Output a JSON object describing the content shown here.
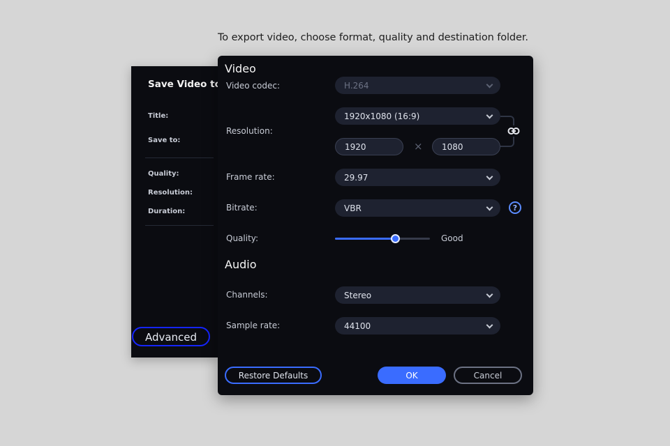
{
  "caption": "To export video, choose format, quality and destination folder.",
  "back_panel": {
    "title": "Save Video to",
    "labels": [
      "Title:",
      "Save to:",
      "Quality:",
      "Resolution:",
      "Duration:"
    ],
    "advanced_button": "Advanced"
  },
  "dialog": {
    "video_section": "Video",
    "video_codec": {
      "label": "Video codec:",
      "value": "H.264",
      "disabled": true
    },
    "resolution": {
      "label": "Resolution:",
      "preset": "1920x1080 (16:9)",
      "width": "1920",
      "height": "1080",
      "separator": "×"
    },
    "frame_rate": {
      "label": "Frame rate:",
      "value": "29.97"
    },
    "bitrate": {
      "label": "Bitrate:",
      "value": "VBR",
      "help": "?"
    },
    "quality": {
      "label": "Quality:",
      "slider_percent": 63,
      "value_label": "Good"
    },
    "audio_section": "Audio",
    "channels": {
      "label": "Channels:",
      "value": "Stereo"
    },
    "sample_rate": {
      "label": "Sample rate:",
      "value": "44100"
    },
    "buttons": {
      "restore": "Restore Defaults",
      "ok": "OK",
      "cancel": "Cancel"
    }
  },
  "colors": {
    "accent": "#3a6cff",
    "advanced_outline": "#1525ff",
    "background": "#0b0c11"
  }
}
